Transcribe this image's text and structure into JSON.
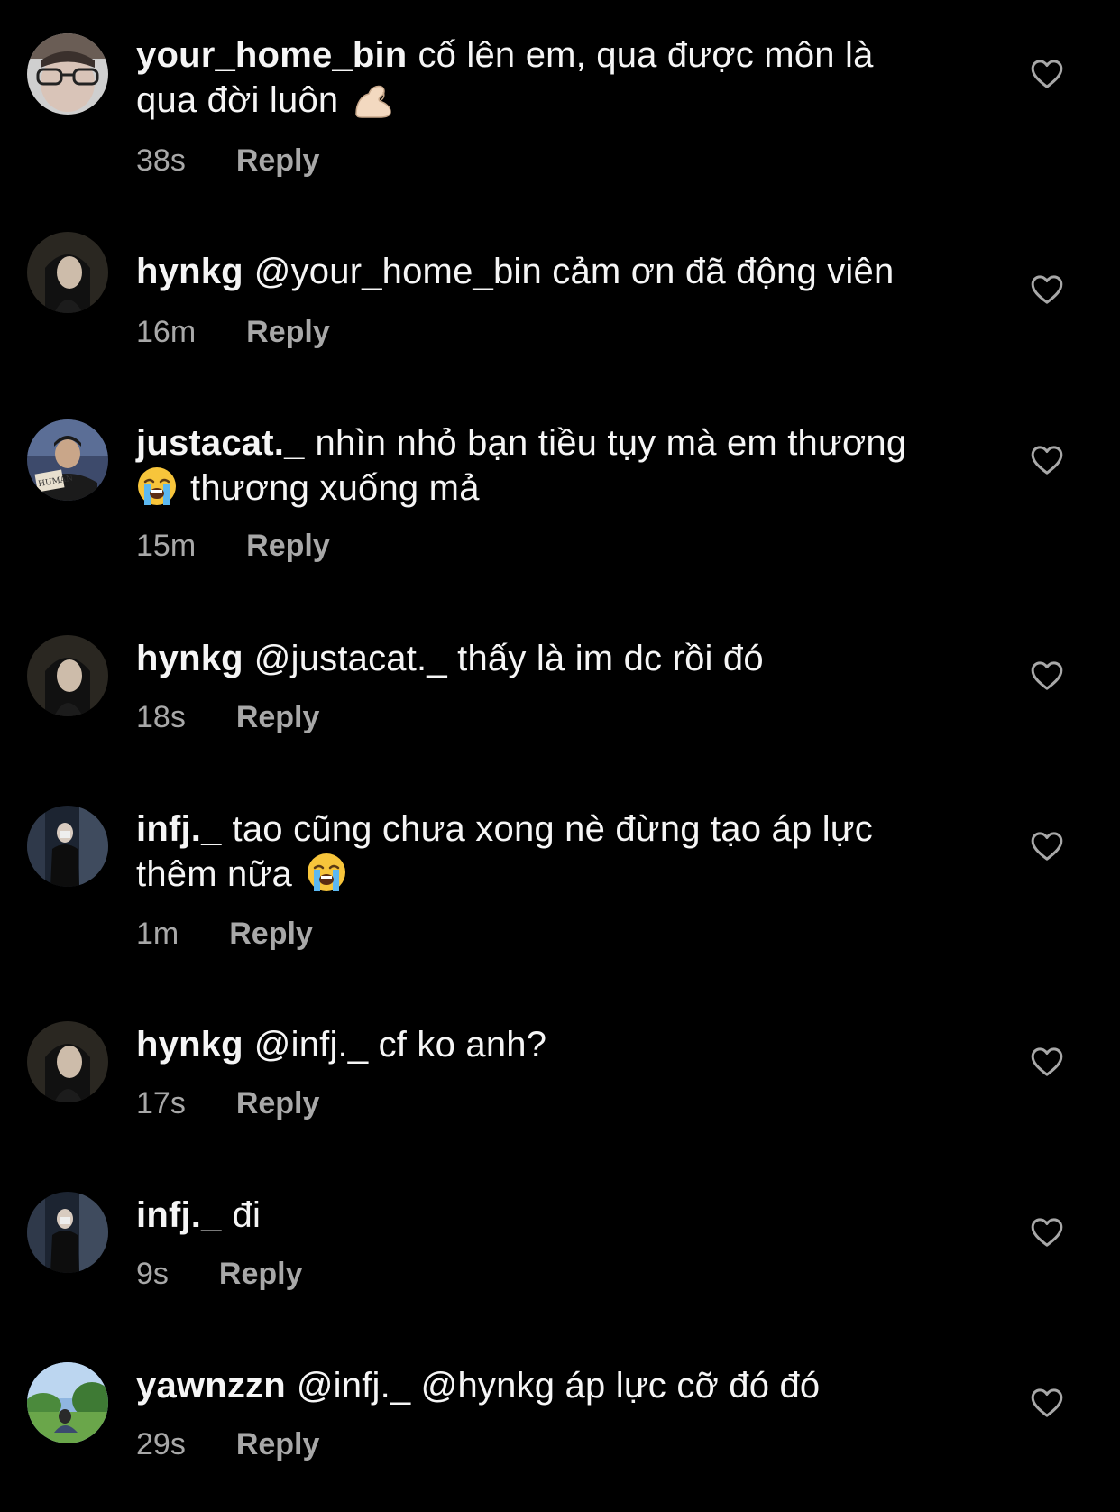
{
  "colors": {
    "background": "#000000",
    "text": "#f5f5f5",
    "secondary_text": "#a8a8a8"
  },
  "comments": [
    {
      "username": "your_home_bin",
      "line1": "cố lên em, qua được môn là",
      "line2": "qua đời luôn",
      "emoji": "flexed-biceps-emoji",
      "time": "38s",
      "reply": "Reply",
      "like_icon": "heart-icon"
    },
    {
      "username": "hynkg",
      "line1": "@your_home_bin cảm ơn đã động viên",
      "time": "16m",
      "reply": "Reply",
      "like_icon": "heart-icon"
    },
    {
      "username": "justacat._",
      "line1": "nhìn nhỏ bạn tiều tụy mà em thương",
      "line2": "thương xuống mả",
      "emoji": "loudly-crying-face-emoji",
      "time": "15m",
      "reply": "Reply",
      "like_icon": "heart-icon"
    },
    {
      "username": "hynkg",
      "line1": "@justacat._ thấy là im dc rồi đó",
      "time": "18s",
      "reply": "Reply",
      "like_icon": "heart-icon"
    },
    {
      "username": "infj._",
      "line1": "tao cũng chưa xong nè đừng tạo áp lực",
      "line2": "thêm nữa",
      "emoji": "loudly-crying-face-emoji",
      "time": "1m",
      "reply": "Reply",
      "like_icon": "heart-icon"
    },
    {
      "username": "hynkg",
      "line1": "@infj._ cf ko anh?",
      "time": "17s",
      "reply": "Reply",
      "like_icon": "heart-icon"
    },
    {
      "username": "infj._",
      "line1": "đi",
      "time": "9s",
      "reply": "Reply",
      "like_icon": "heart-icon"
    },
    {
      "username": "yawnzzn",
      "line1": "@infj._ @hynkg áp lực cỡ đó đó",
      "time": "29s",
      "reply": "Reply",
      "like_icon": "heart-icon"
    }
  ]
}
